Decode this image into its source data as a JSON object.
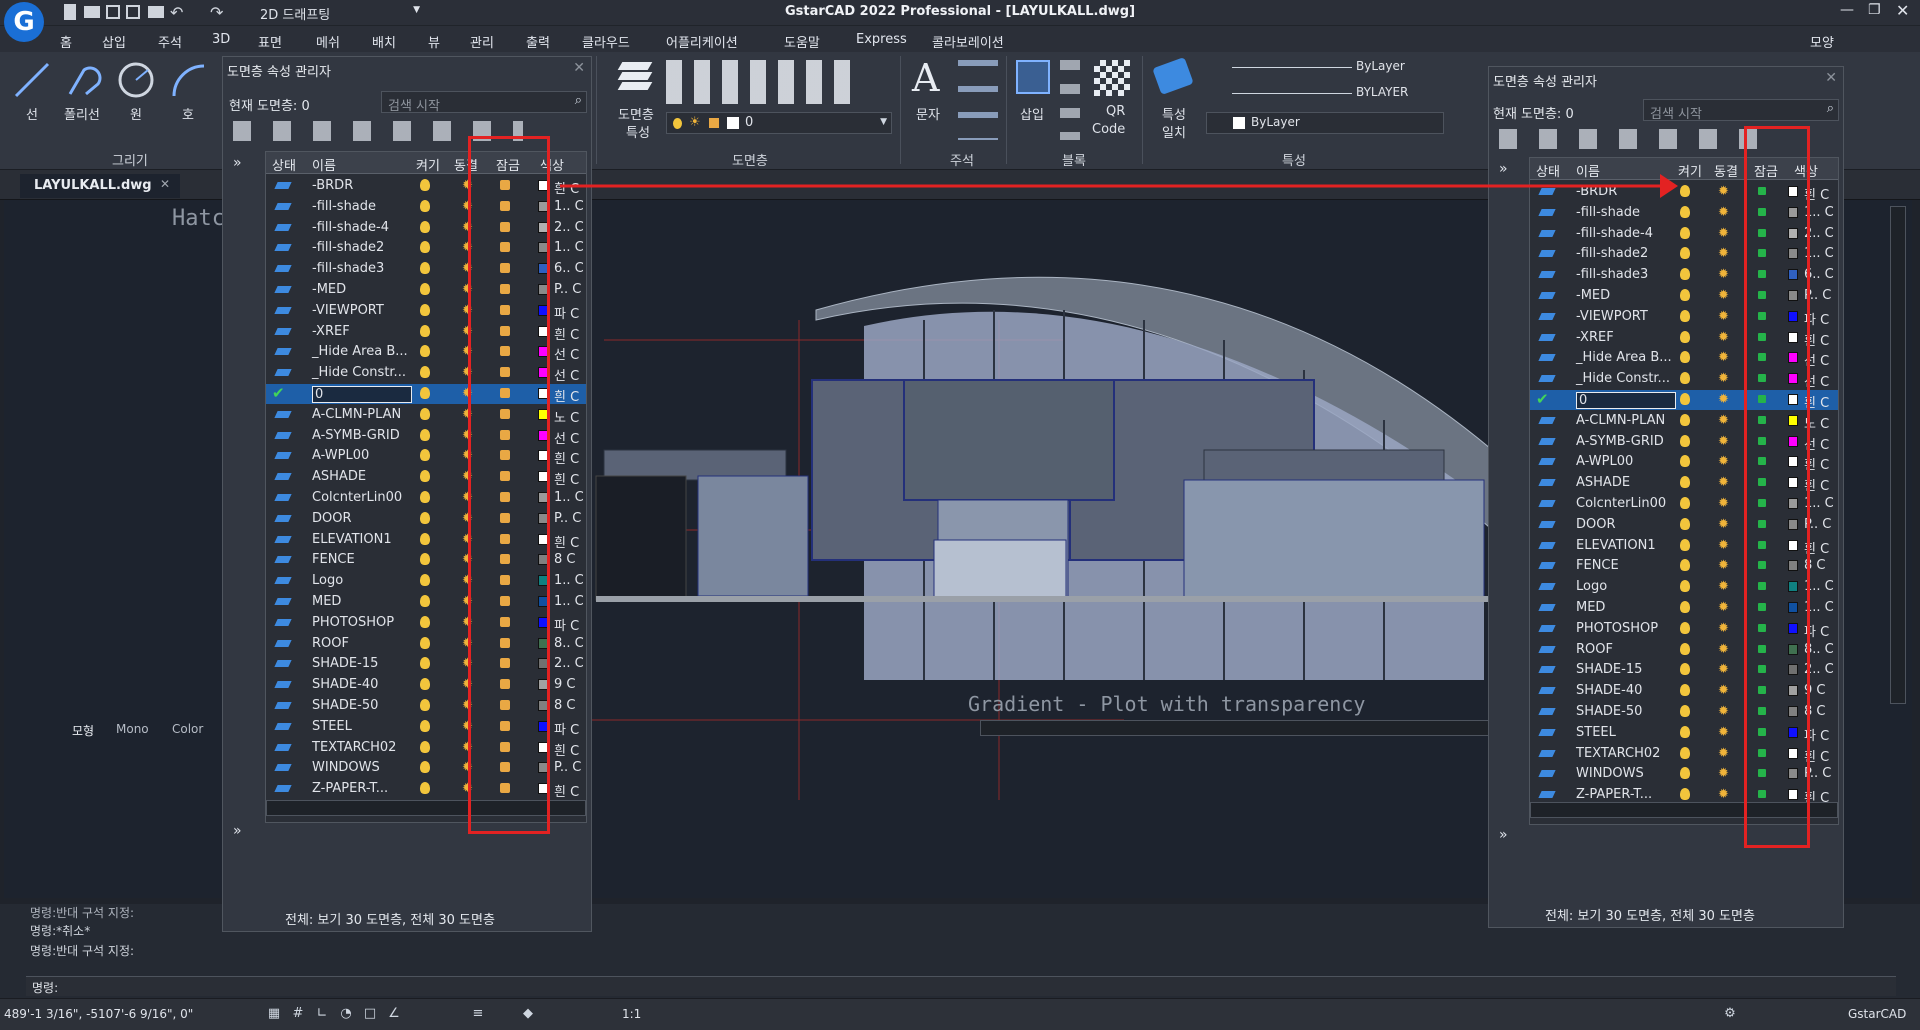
{
  "app": {
    "title": "GstarCAD 2022 Professional - [LAYULKALL.dwg]",
    "workspace": "2D 드래프팅",
    "view_label": "모양"
  },
  "menus": [
    "홈",
    "삽입",
    "주석",
    "3D",
    "표면",
    "메쉬",
    "배치",
    "뷰",
    "관리",
    "출력",
    "클라우드",
    "어플리케이션",
    "도움말",
    "Express",
    "콜라보레이션"
  ],
  "ribbon": {
    "draw": {
      "line": "선",
      "polyline": "폴리선",
      "circle": "원",
      "arc": "호",
      "group": "그리기"
    },
    "layer": {
      "props": "도면층",
      "props2": "특성",
      "current_value": "0",
      "group": "도면층"
    },
    "text": {
      "label": "문자",
      "group": "주석"
    },
    "block": {
      "insert": "삽입",
      "qr": "QR",
      "qr2": "Code",
      "group": "블록"
    },
    "props": {
      "match": "특성",
      "match2": "일치",
      "bylayer1": "ByLayer",
      "bylayer2": "BYLAYER",
      "bylayer3": "ByLayer",
      "group": "특성"
    }
  },
  "doc_tab": "LAYULKALL.dwg",
  "canvas": {
    "hatch_label": "Hatc",
    "gradient_label": "Gradient - Plot with transparency"
  },
  "layout_tabs": [
    "모형",
    "Mono",
    "Color"
  ],
  "layer_panel": {
    "title": "도면층 속성 관리자",
    "current": "현재 도면층: 0",
    "search": "검색 시작",
    "headers": {
      "status": "상태",
      "name": "이름",
      "on": "켜기",
      "freeze": "동결",
      "lock": "잠금",
      "color": "색상"
    },
    "summary": "전체: 보기 30 도면층, 전체 30 도면층"
  },
  "layers": [
    {
      "name": "-BRDR",
      "color": "#ffffff",
      "cname": "흰 C"
    },
    {
      "name": "-fill-shade",
      "color": "#9a9a9a",
      "cname": "1.. C"
    },
    {
      "name": "-fill-shade-4",
      "color": "#b0b0b0",
      "cname": "2.. C"
    },
    {
      "name": "-fill-shade2",
      "color": "#8a8a8a",
      "cname": "1.. C"
    },
    {
      "name": "-fill-shade3",
      "color": "#3060c0",
      "cname": "6.. C"
    },
    {
      "name": "-MED",
      "color": "#8a8a8a",
      "cname": "P.. C"
    },
    {
      "name": "-VIEWPORT",
      "color": "#1010ff",
      "cname": "파 C"
    },
    {
      "name": "-XREF",
      "color": "#ffffff",
      "cname": "흰 C"
    },
    {
      "name": "_Hide Area B...",
      "color": "#ff00ff",
      "cname": "선 C"
    },
    {
      "name": "_Hide Constr...",
      "color": "#ff00ff",
      "cname": "선 C"
    },
    {
      "name": "0",
      "color": "#ffffff",
      "cname": "흰 C",
      "selected": true
    },
    {
      "name": "A-CLMN-PLAN",
      "color": "#ffff00",
      "cname": "노 C"
    },
    {
      "name": "A-SYMB-GRID",
      "color": "#ff00ff",
      "cname": "선 C"
    },
    {
      "name": "A-WPL00",
      "color": "#ffffff",
      "cname": "흰 C"
    },
    {
      "name": "ASHADE",
      "color": "#ffffff",
      "cname": "흰 C"
    },
    {
      "name": "ColcnterLin00",
      "color": "#9a9a9a",
      "cname": "1.. C"
    },
    {
      "name": "DOOR",
      "color": "#8a8a8a",
      "cname": "P.. C"
    },
    {
      "name": "ELEVATION1",
      "color": "#ffffff",
      "cname": "흰 C"
    },
    {
      "name": "FENCE",
      "color": "#808080",
      "cname": "8 C"
    },
    {
      "name": "Logo",
      "color": "#108080",
      "cname": "1.. C"
    },
    {
      "name": "MED",
      "color": "#1050a0",
      "cname": "1.. C"
    },
    {
      "name": "PHOTOSHOP",
      "color": "#1010ff",
      "cname": "파 C"
    },
    {
      "name": "ROOF",
      "color": "#407050",
      "cname": "8.. C"
    },
    {
      "name": "SHADE-15",
      "color": "#707070",
      "cname": "2.. C"
    },
    {
      "name": "SHADE-40",
      "color": "#a0a0a0",
      "cname": "9 C"
    },
    {
      "name": "SHADE-50",
      "color": "#808080",
      "cname": "8 C"
    },
    {
      "name": "STEEL",
      "color": "#1010ff",
      "cname": "파 C"
    },
    {
      "name": "TEXTARCH02",
      "color": "#ffffff",
      "cname": "흰 C"
    },
    {
      "name": "WINDOWS",
      "color": "#8a8a8a",
      "cname": "P.. C"
    },
    {
      "name": "Z-PAPER-T...",
      "color": "#ffffff",
      "cname": "흰 C"
    }
  ],
  "command": {
    "lines": [
      "명령:반대 구석 지정:",
      "명령:*취소*",
      "명령:반대 구석 지정:"
    ],
    "prompt": "명령:"
  },
  "status": {
    "coords": "489'-1 3/16\", -5107'-6 9/16\", 0\"",
    "scale": "1:1",
    "brand": "GstarCAD"
  }
}
